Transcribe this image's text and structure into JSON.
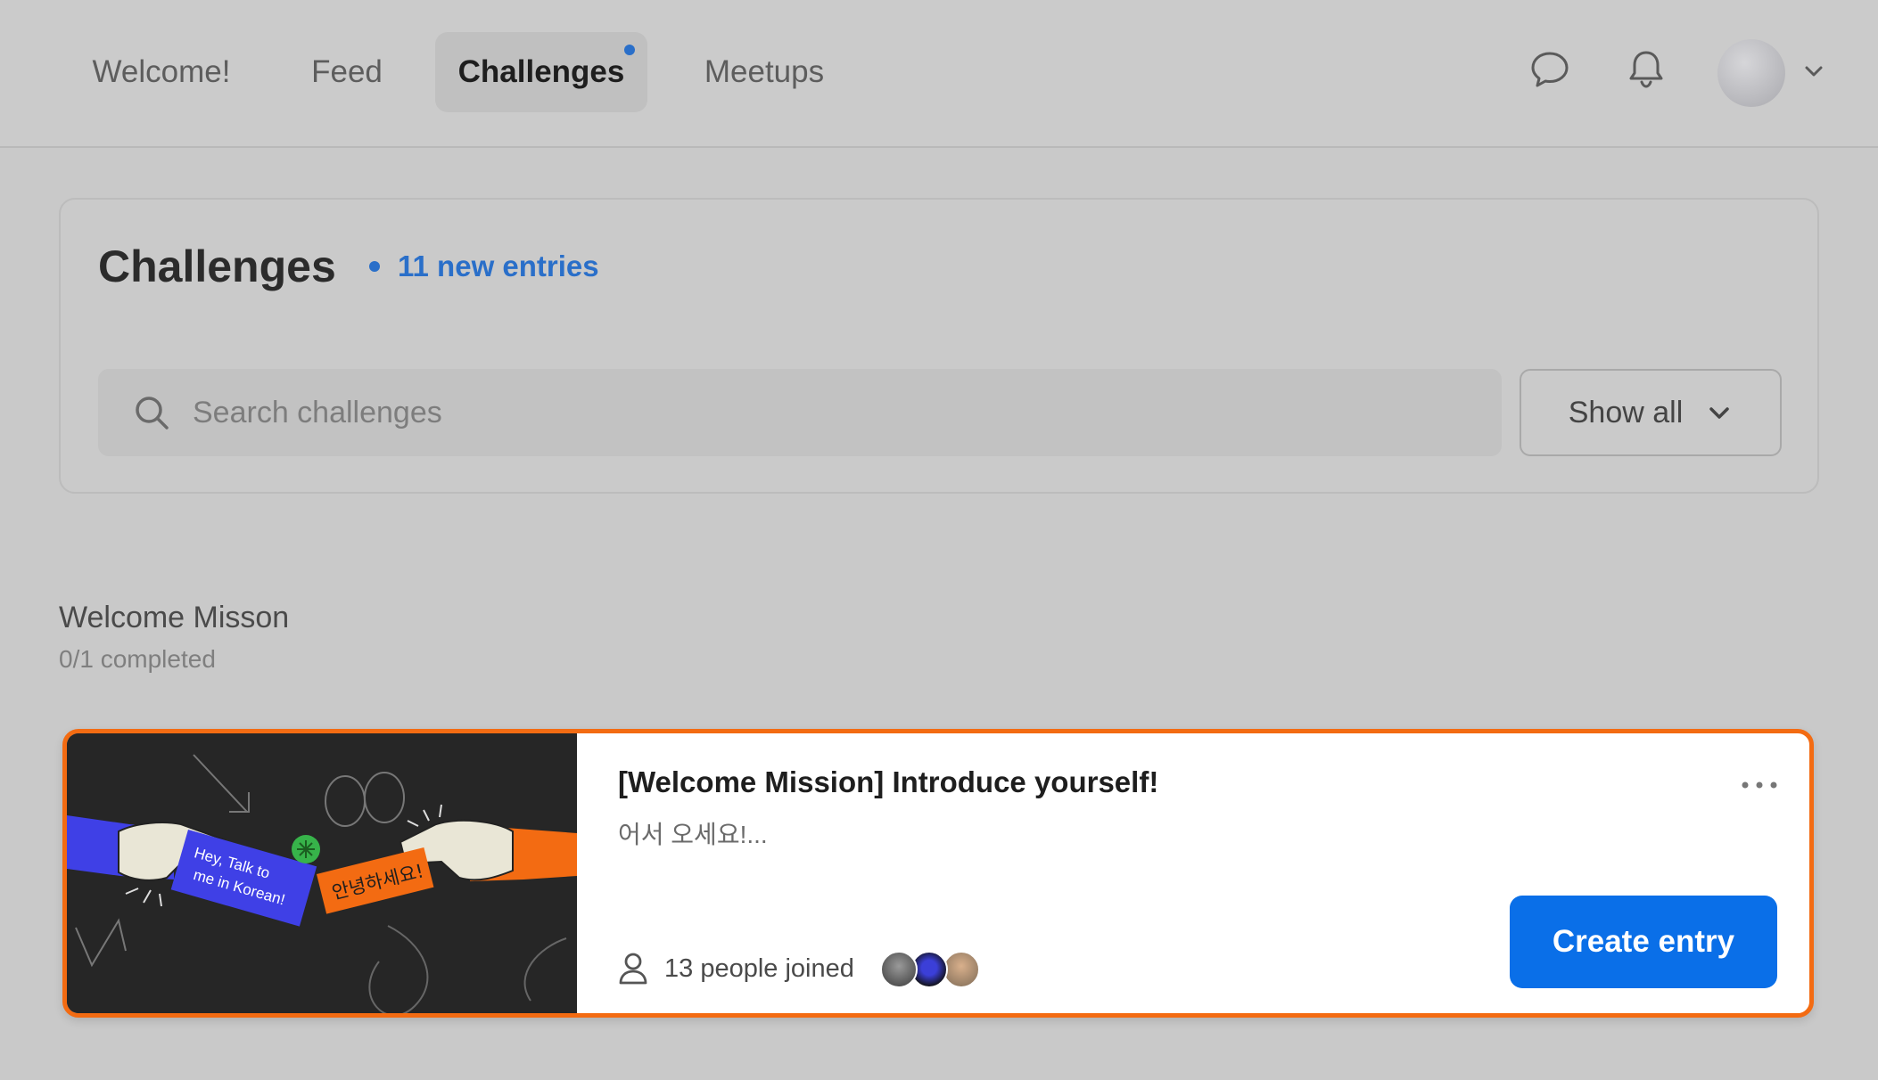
{
  "nav": {
    "tabs": [
      {
        "label": "Welcome!",
        "active": false
      },
      {
        "label": "Feed",
        "active": false
      },
      {
        "label": "Challenges",
        "active": true,
        "has_indicator": true
      },
      {
        "label": "Meetups",
        "active": false
      }
    ],
    "icons": [
      "chat-bubble-icon",
      "bell-icon",
      "user-avatar",
      "chevron-down-icon"
    ]
  },
  "panel": {
    "title": "Challenges",
    "new_entries": "11 new entries",
    "search_placeholder": "Search challenges",
    "filter_label": "Show all"
  },
  "section": {
    "title": "Welcome Misson",
    "progress": "0/1 completed"
  },
  "card": {
    "title": "[Welcome Mission] Introduce yourself!",
    "description": "어서 오세요!...",
    "joined": "13 people joined",
    "create_label": "Create entry",
    "image_text": {
      "left_bubble_line1": "Hey, Talk to",
      "left_bubble_line2": "me in Korean!",
      "right_bubble": "안녕하세요!"
    }
  },
  "colors": {
    "accent_blue": "#0a6fe8",
    "link_blue": "#2a6fc9",
    "highlight_orange": "#f36b12",
    "page_bg": "#c9c9c9"
  }
}
